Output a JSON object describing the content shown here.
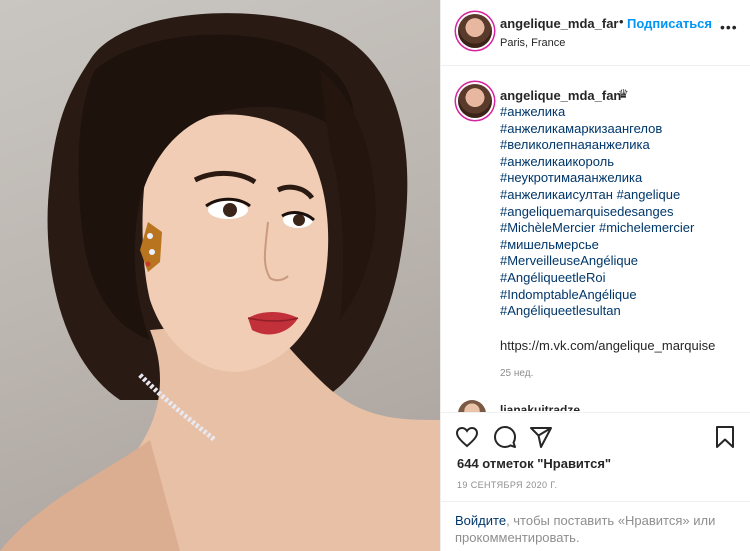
{
  "header": {
    "username": "angelique_mda_far",
    "separator": "•",
    "follow_label": "Подписаться",
    "location": "Paris, France",
    "more_label": "•••"
  },
  "comment": {
    "username": "angelique_mda_fan",
    "crown": "♛",
    "tags": [
      "#анжелика",
      "#анжеликамаркизаангелов",
      "#великолепнаяанжелика",
      "#анжеликаикороль",
      "#неукротимаяанжелика",
      "#анжеликаисултан #angelique",
      "#angeliquemarquisedesanges",
      "#MichèleMercier #michelemercier",
      "#мишельмерсье",
      "#MerveilleuseAngélique",
      "#AngéliqueetleRoi",
      "#IndomptableAngélique",
      "#Angéliqueetlesultan"
    ],
    "link": "https://m.vk.com/angelique_marquise",
    "time_ago": "25 нед."
  },
  "next_comment": {
    "username": "lianakuitradze"
  },
  "actions": {
    "like_icon": "heart-icon",
    "comment_icon": "comment-icon",
    "share_icon": "share-icon",
    "save_icon": "bookmark-icon"
  },
  "likes_text": "644 отметок \"Нравится\"",
  "date_text": "19 СЕНТЯБРЯ 2020 Г.",
  "login_prompt": {
    "link_label": "Войдите",
    "rest": ", чтобы поставить «Нравится» или прокомментировать."
  },
  "colors": {
    "link_blue": "#0095f6",
    "hashtag": "#00376b",
    "muted": "#8e8e8e"
  }
}
